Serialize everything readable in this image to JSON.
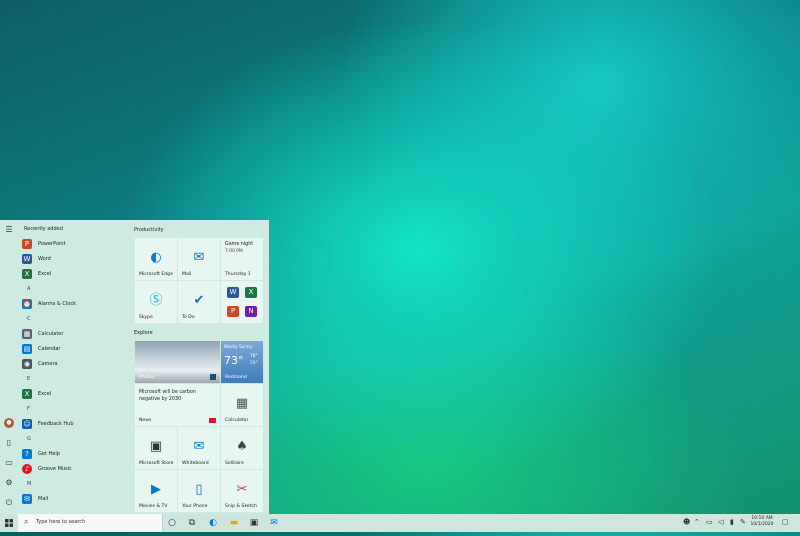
{
  "start_menu": {
    "list_header": "Recently added",
    "apps": [
      {
        "label": "PowerPoint",
        "color": "#d24726",
        "glyph": "P"
      },
      {
        "label": "Word",
        "color": "#2b579a",
        "glyph": "W"
      },
      {
        "label": "Excel",
        "color": "#217346",
        "glyph": "X"
      }
    ],
    "letter_a": "A",
    "alarms": {
      "label": "Alarms & Clock",
      "color": "#0078d4",
      "glyph": "⏰"
    },
    "letter_c": "C",
    "calculator": {
      "label": "Calculator",
      "color": "#5a6470",
      "glyph": "▦"
    },
    "calendar": {
      "label": "Calendar",
      "color": "#0078d4",
      "glyph": "▤"
    },
    "camera": {
      "label": "Camera",
      "color": "#4a5560",
      "glyph": "◉"
    },
    "letter_e": "E",
    "excel2": {
      "label": "Excel",
      "color": "#217346",
      "glyph": "X"
    },
    "letter_f": "F",
    "feedback": {
      "label": "Feedback Hub",
      "color": "#0063b1",
      "glyph": "☺"
    },
    "letter_g": "G",
    "gethelp": {
      "label": "Get Help",
      "color": "#0078d4",
      "glyph": "?"
    },
    "groove": {
      "label": "Groove Music",
      "color": "#e81123",
      "glyph": "♪"
    },
    "letter_m": "M",
    "mail": {
      "label": "Mail",
      "color": "#0078d4",
      "glyph": "✉"
    },
    "rail_icons": [
      "hamburger-icon",
      "avatar",
      "document-icon",
      "pictures-icon",
      "settings-icon",
      "power-icon"
    ]
  },
  "tiles": {
    "productivity_header": "Productivity",
    "edge": "Microsoft Edge",
    "mail": "Mail",
    "calendar_title": "Game night",
    "calendar_time": "7:00 PM",
    "calendar_date": "Thursday 1",
    "skype": "Skype",
    "todo": "To Do",
    "explore_header": "Explore",
    "news_caption": "Photos",
    "weather_top": "Mostly Sunny",
    "weather_temp": "73°",
    "weather_hi": "78°",
    "weather_lo": "59°",
    "weather_city": "Redmond",
    "news_text": "Microsoft will be carbon negative by 2030",
    "news_label": "News",
    "calculator": "Calculator",
    "store": "Microsoft Store",
    "whiteboard": "Whiteboard",
    "solitaire": "Solitaire",
    "movies": "Movies & TV",
    "phone": "Your Phone",
    "snip": "Snip & Sketch"
  },
  "taskbar": {
    "search_placeholder": "Type here to search",
    "time": "10:10 AM",
    "date": "10/1/2020"
  }
}
